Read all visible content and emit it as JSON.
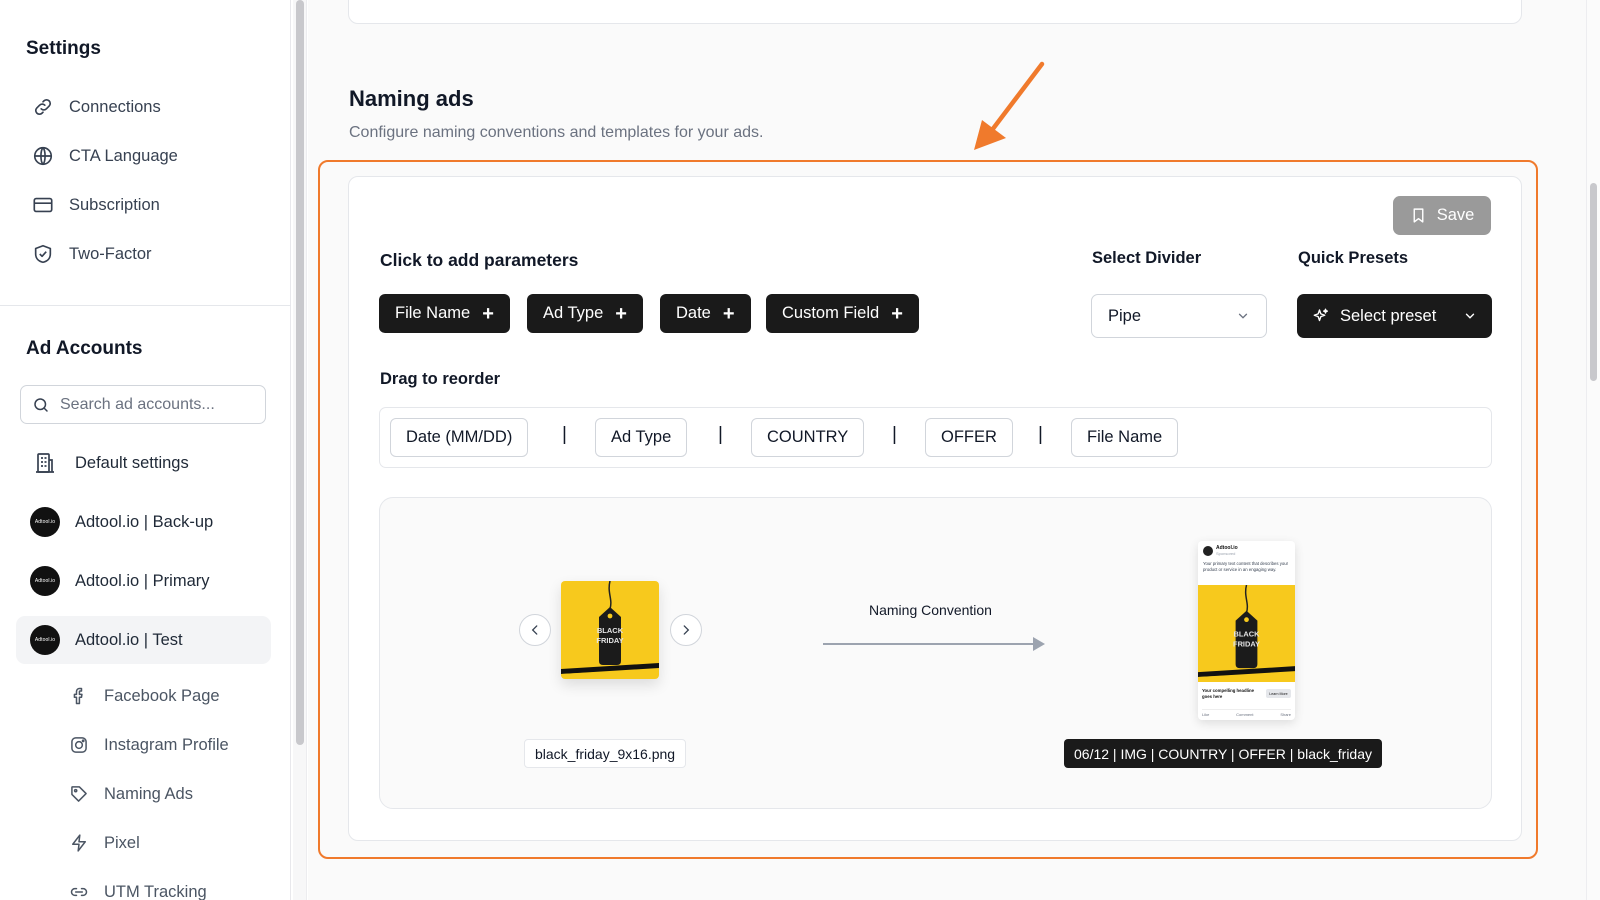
{
  "sidebar": {
    "title": "Settings",
    "nav": [
      {
        "label": "Connections",
        "icon": "link-icon"
      },
      {
        "label": "CTA Language",
        "icon": "globe-icon"
      },
      {
        "label": "Subscription",
        "icon": "credit-card-icon"
      },
      {
        "label": "Two-Factor",
        "icon": "shield-check-icon"
      }
    ],
    "accounts_title": "Ad Accounts",
    "search_placeholder": "Search ad accounts...",
    "default_settings": "Default settings",
    "accounts": [
      {
        "label": "Adtool.io | Back-up",
        "avatar_text": "Adtool.io"
      },
      {
        "label": "Adtool.io | Primary",
        "avatar_text": "Adtool.io"
      },
      {
        "label": "Adtool.io | Test",
        "avatar_text": "Adtool.io",
        "active": true
      }
    ],
    "sub_items": [
      {
        "label": "Facebook Page",
        "icon": "facebook-icon"
      },
      {
        "label": "Instagram Profile",
        "icon": "instagram-icon"
      },
      {
        "label": "Naming Ads",
        "icon": "tag-icon"
      },
      {
        "label": "Pixel",
        "icon": "bolt-icon"
      },
      {
        "label": "UTM Tracking",
        "icon": "link-icon"
      }
    ]
  },
  "section": {
    "title": "Naming ads",
    "description": "Configure naming conventions and templates for your ads."
  },
  "editor": {
    "save_label": "Save",
    "params_title": "Click to add parameters",
    "params": [
      "File Name",
      "Ad Type",
      "Date",
      "Custom Field"
    ],
    "divider_title": "Select Divider",
    "divider_value": "Pipe",
    "presets_title": "Quick Presets",
    "preset_label": "Select preset",
    "reorder_title": "Drag to reorder",
    "tokens": [
      "Date (MM/DD)",
      "Ad Type",
      "COUNTRY",
      "OFFER",
      "File Name"
    ],
    "separator": "|"
  },
  "preview": {
    "creative_text": [
      "BLACK",
      "FRIDAY"
    ],
    "file_name": "black_friday_9x16.png",
    "convention_label": "Naming Convention",
    "result": "06/12 | IMG | COUNTRY | OFFER | black_friday",
    "mock_post": {
      "page_name": "Adtool.io",
      "sponsored": "Sponsored",
      "primary_text": "Your primary text content that describes your product or service in an engaging way.",
      "headline": "Your compelling headline goes here",
      "cta": "Learn More",
      "actions": [
        "Like",
        "Comment",
        "Share"
      ]
    }
  },
  "colors": {
    "highlight": "#f07a2c",
    "chip_bg": "#1a1a1a",
    "save_bg": "#9a9a9a",
    "creative_yellow": "#f7c91d"
  }
}
